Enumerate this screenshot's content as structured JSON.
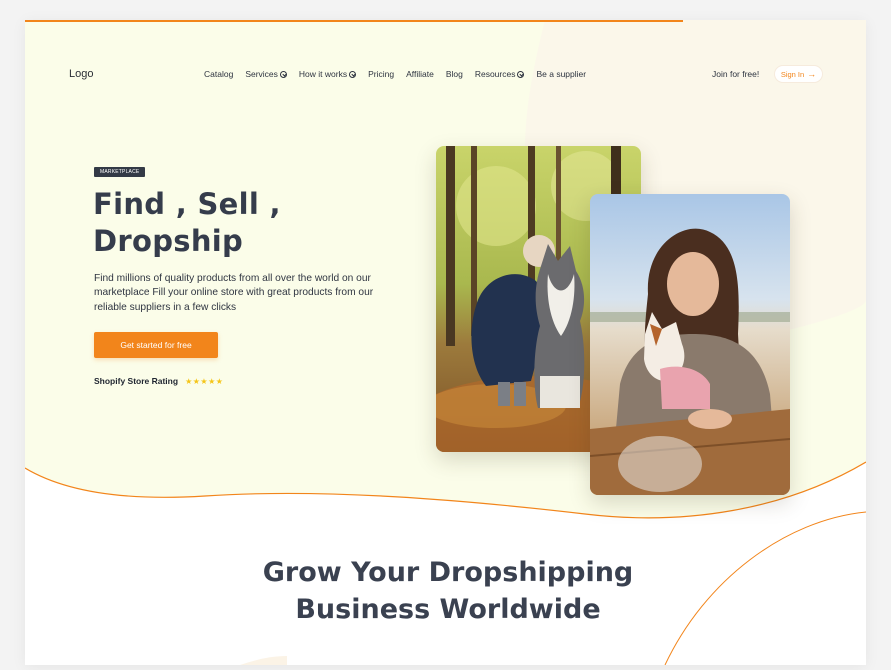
{
  "header": {
    "logo": "Logo",
    "nav": [
      {
        "label": "Catalog",
        "dropdown": false
      },
      {
        "label": "Services",
        "dropdown": true
      },
      {
        "label": "How it works",
        "dropdown": true
      },
      {
        "label": "Pricing",
        "dropdown": false
      },
      {
        "label": "Affiliate",
        "dropdown": false
      },
      {
        "label": "Blog",
        "dropdown": false
      },
      {
        "label": "Resources",
        "dropdown": true
      },
      {
        "label": "Be a supplier",
        "dropdown": false
      }
    ],
    "join_label": "Join for free!",
    "signin_label": "Sign In",
    "signin_icon": "arrow-right-icon"
  },
  "hero": {
    "badge": "MARKETPLACE",
    "headline_line1": "Find , Sell ,",
    "headline_line2": "Dropship",
    "subtext": "Find millions of quality products from all over the world on our marketplace Fill your online store with great products from our reliable suppliers in a few clicks",
    "cta_label": "Get started for free",
    "rating_label": "Shopify Store Rating",
    "rating_stars": "★★★★★",
    "rating_value": 5
  },
  "section": {
    "title_line1": "Grow Your Dropshipping",
    "title_line2": "Business Worldwide"
  },
  "colors": {
    "accent": "#f2851b",
    "hero_background": "#fbfde9",
    "text_dark": "#353c4b",
    "star": "#f5c518"
  }
}
